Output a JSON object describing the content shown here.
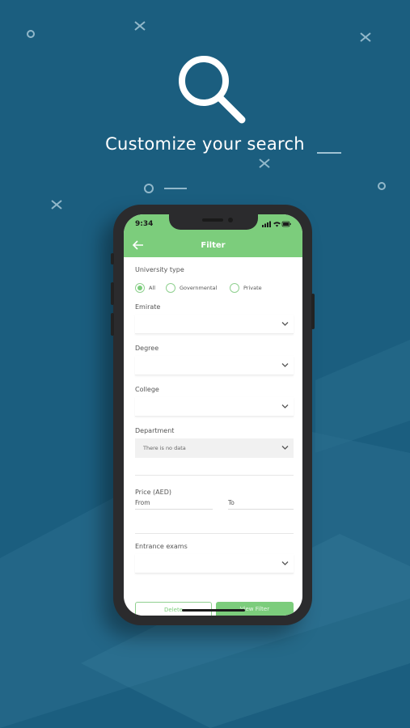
{
  "headline": "Customize your search",
  "status_bar": {
    "time": "9:34"
  },
  "appbar": {
    "title": "Filter"
  },
  "form": {
    "university_type": {
      "label": "University type",
      "options": [
        "All",
        "Governmental",
        "Private"
      ],
      "selected": "All"
    },
    "emirate": {
      "label": "Emirate",
      "value": ""
    },
    "degree": {
      "label": "Degree",
      "value": ""
    },
    "college": {
      "label": "College",
      "value": ""
    },
    "department": {
      "label": "Department",
      "value": "There is no data"
    },
    "price": {
      "label": "Price (AED)",
      "from_label": "From",
      "to_label": "To"
    },
    "entrance_exams": {
      "label": "Entrance exams",
      "value": ""
    }
  },
  "buttons": {
    "delete_label": "Delete",
    "view_label": "View Filter"
  },
  "colors": {
    "background": "#1b5e7f",
    "accent_green": "#7ccd7c",
    "phone_frame": "#2b2b2d"
  }
}
